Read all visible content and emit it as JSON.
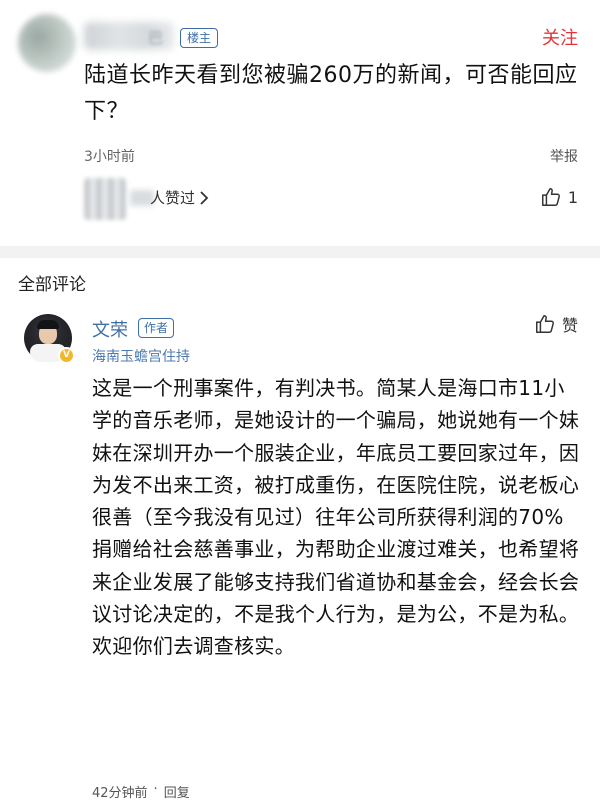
{
  "post": {
    "op_badge": "楼主",
    "name_tail": "巴",
    "follow_label": "关注",
    "text": "陆道长昨天看到您被骗260万的新闻，可否能回应下？",
    "time": "3小时前",
    "report_label": "举报",
    "liked_by_label": "人赞过",
    "like_count": "1"
  },
  "comments": {
    "section_title": "全部评论",
    "author": {
      "name": "文荣",
      "badge": "作者",
      "description": "海南玉蟾宫住持"
    },
    "like_label": "赞",
    "text": "这是一个刑事案件，有判决书。简某人是海口市11小学的音乐老师，是她设计的一个骗局，她说她有一个妹妹在深圳开办一个服装企业，年底员工要回家过年，因为发不出来工资，被打成重伤，在医院住院，说老板心很善（至今我没有见过）往年公司所获得利润的70%捐赠给社会慈善事业，为帮助企业渡过难关，也希望将来企业发展了能够支持我们省道协和基金会，经会长会议讨论决定的，不是我个人行为，是为公，不是为私。欢迎你们去调查核实。",
    "time": "42分钟前",
    "separator": "·",
    "reply_label": "回复"
  },
  "colors": {
    "accent_blue": "#3f6fa8",
    "follow_red": "#e2343a",
    "verified_gold": "#f2b82b"
  },
  "icons": [
    "chevron-right-icon",
    "thumbs-up-icon",
    "verified-v-icon"
  ]
}
